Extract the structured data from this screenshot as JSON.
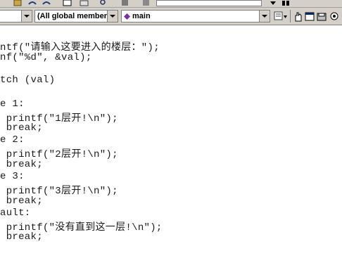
{
  "toolbar_top": {
    "buttons": [
      "paste-icon",
      "undo-icon",
      "redo-icon",
      "open-icon",
      "save-icon",
      "find-icon",
      "compile-icon"
    ]
  },
  "toolbar_scope": {
    "first_combo_value": "",
    "members_combo_value": "(All global member",
    "function_combo_value": "main",
    "function_icon": "diamond-purple",
    "member_icon_color": "#7a2fa0"
  },
  "code_lines": [
    "ntf(\"请输入这要进入的楼层：\");",
    "nf(\"%d\", &val);",
    "",
    "tch (val)",
    "",
    "e 1:",
    " printf(\"1层开!\\n\");",
    " break;",
    "e 2:",
    " printf(\"2层开!\\n\");",
    " break;",
    "e 3:",
    " printf(\"3层开!\\n\");",
    " break;",
    "ault:",
    " printf(\"没有直到这一层!\\n\");",
    " break;"
  ]
}
